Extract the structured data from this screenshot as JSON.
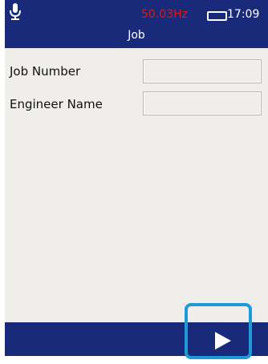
{
  "status_bar": {
    "frequency": "50.03Hz",
    "time": "17:09",
    "mic_icon": "microphone-icon",
    "battery_icon": "battery-icon"
  },
  "header": {
    "title": "Job"
  },
  "form": {
    "fields": [
      {
        "label": "Job Number",
        "value": ""
      },
      {
        "label": "Engineer Name",
        "value": ""
      }
    ]
  },
  "footer": {
    "next_icon": "play-icon"
  },
  "colors": {
    "header_bg": "#1a2a7a",
    "frequency_text": "#d41a1a",
    "highlight": "#1e9ad6",
    "screen_bg": "#f0eeeb"
  }
}
